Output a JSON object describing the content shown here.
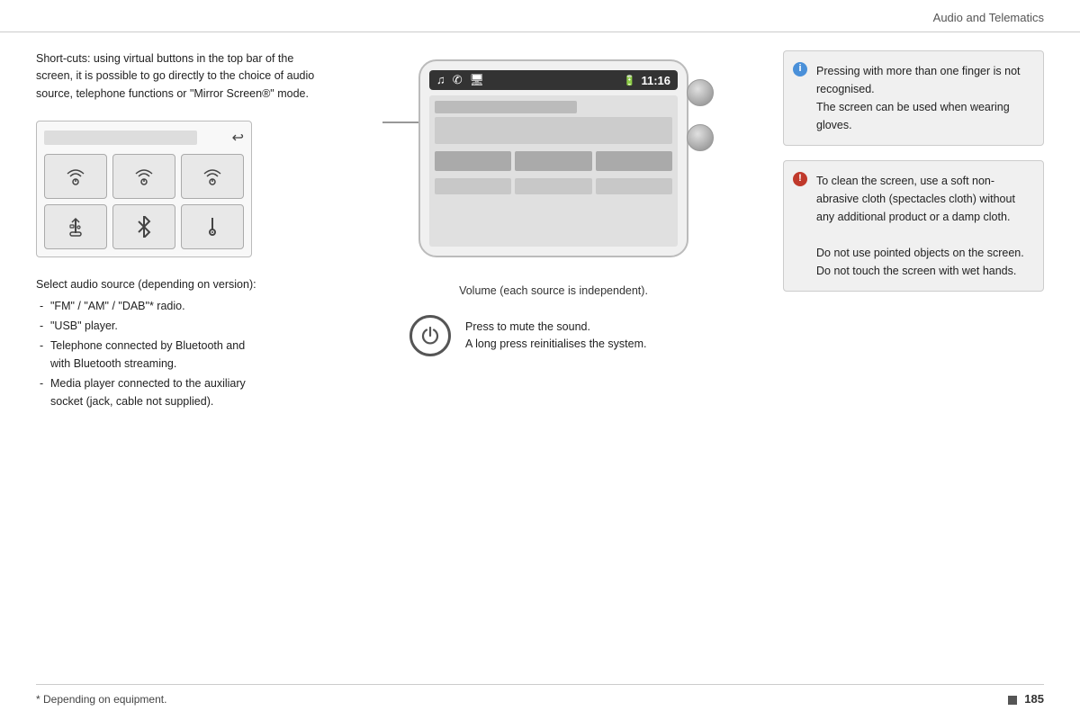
{
  "header": {
    "title": "Audio and Telematics"
  },
  "left": {
    "shortcut_text": "Short-cuts: using virtual buttons in the top bar of the screen, it is possible to go directly to the choice of audio source, telephone functions or \"Mirror Screen®\" mode.",
    "source_grid": {
      "back_symbol": "↩",
      "buttons": [
        {
          "icon": "📡",
          "label": "radio-1"
        },
        {
          "icon": "📡",
          "label": "radio-2"
        },
        {
          "icon": "📡",
          "label": "radio-3"
        },
        {
          "icon": "⚡",
          "label": "usb"
        },
        {
          "icon": "🔵",
          "label": "bluetooth"
        },
        {
          "icon": "🎵",
          "label": "aux"
        }
      ]
    },
    "select_audio_title": "Select audio source (depending on version):",
    "select_audio_items": [
      "\"FM\" / \"AM\" / \"DAB\"* radio.",
      "\"USB\" player.",
      "Telephone connected by Bluetooth and with Bluetooth streaming.",
      "Media player connected to the auxiliary socket (jack, cable not supplied)."
    ]
  },
  "middle": {
    "screen": {
      "time": "11:16",
      "top_icons": [
        "♫",
        "✆",
        "🎵"
      ]
    },
    "volume_text": "Volume (each source is independent).",
    "mute_label": "Press to mute the sound.",
    "mute_label2": "A long press reinitialises the system.",
    "power_symbol": "⏻"
  },
  "right": {
    "info_note": {
      "icon": "i",
      "lines": [
        "Pressing with more than one finger is not recognised.",
        "The screen can be used when wearing gloves."
      ]
    },
    "warning_note": {
      "icon": "!",
      "lines": [
        "To clean the screen, use a soft non-abrasive cloth (spectacles cloth) without any additional product or a damp cloth.",
        "Do not use pointed objects on the screen.",
        "Do not touch the screen with wet hands."
      ]
    }
  },
  "footer": {
    "note": "* Depending on equipment.",
    "page_number": "185"
  }
}
